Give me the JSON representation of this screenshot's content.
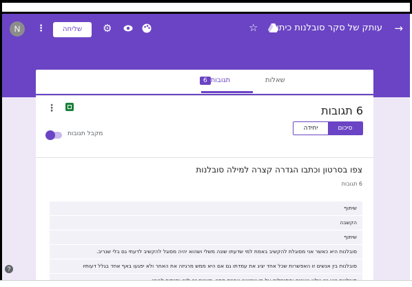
{
  "colors": {
    "accent": "#6a44c4",
    "header_bg": "#6a44c4",
    "page_bg": "#ede7f6",
    "sheets_green": "#188038"
  },
  "header": {
    "avatar_letter": "N",
    "send_label": "שליחה",
    "title": "עותק של סקר סובלנות כיתו",
    "icons": [
      "more-vert-icon",
      "settings-icon",
      "preview-eye-icon",
      "palette-icon",
      "star-icon",
      "drive-icon",
      "back-arrow-icon"
    ]
  },
  "tabs": {
    "questions": "שאלות",
    "responses": "תגובות",
    "responses_count": "6"
  },
  "summary": {
    "count_title": "6 תגובות",
    "view_summary": "סיכום",
    "view_individual": "יחידה",
    "accepting_label": "מקבל תגובות"
  },
  "question": {
    "title": "צפו בסרטון וכתבו הגדרה קצרה למילה סובלנות",
    "count": "6 תגובות",
    "answers": [
      "שיתוף",
      "הקשבה",
      "שיתוף",
      "סובלנות היא כאשר אני מסוגלת להקשיב באמת למי שדעתו שונה משלי ושהוא יהיה מסוגל להקשיב לדעתי גם בלי שנריב.",
      "סובלנות בין אנשים זו האפשרות שכל אחד יציג את עמדתו גם אם היא ממש מרגיזה את האחר ולא יפגעו באף אחד בגלל דעותיו",
      "סובלנות היא זה שלא נוצרים ומתנפלים על מי שחושב אחרת ממך, משנים זה לזה ומנסים להבין"
    ]
  },
  "help_label": "?"
}
